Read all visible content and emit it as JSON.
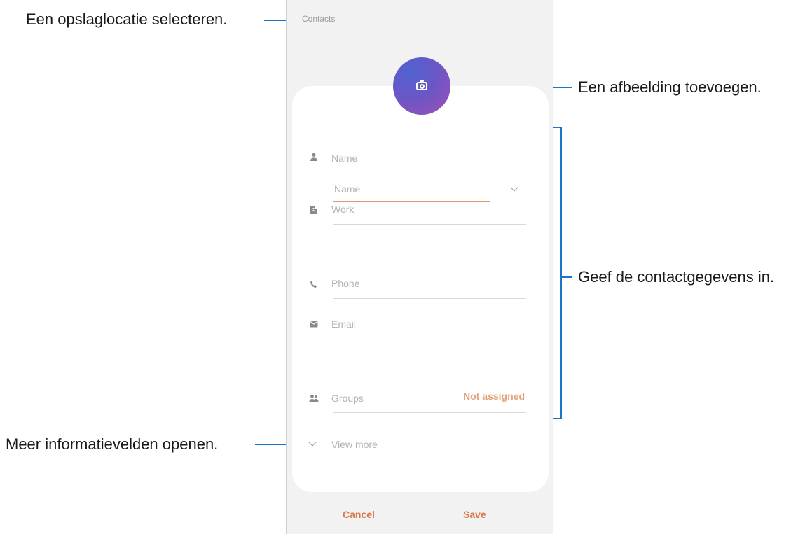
{
  "annotations": {
    "storage": "Een opslaglocatie selecteren.",
    "image": "Een afbeelding toevoegen.",
    "contact_info": "Geef de contactgegevens in.",
    "more_fields": "Meer informatievelden openen."
  },
  "screen": {
    "storage_location": "Contacts",
    "avatar_icon": "camera-icon",
    "fields": {
      "name": "Name",
      "name_sub": "Name",
      "work": "Work",
      "phone": "Phone",
      "email": "Email",
      "groups": "Groups",
      "groups_value": "Not assigned",
      "view_more": "View more"
    },
    "buttons": {
      "cancel": "Cancel",
      "save": "Save"
    }
  },
  "colors": {
    "callout_line": "#1976c9",
    "accent": "#d7774b",
    "avatar_gradient": [
      "#4f63d0",
      "#9c4fb6"
    ]
  }
}
